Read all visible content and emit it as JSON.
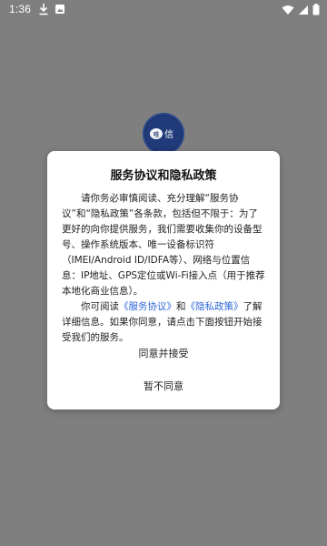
{
  "status_bar": {
    "time": "1:36"
  },
  "app": {
    "logo_text": "唯信"
  },
  "dialog": {
    "title": "服务协议和隐私政策",
    "p1": "请你务必审慎阅读、充分理解“服务协议”和“隐私政策”各条款，包括但不限于：为了更好的向你提供服务，我们需要收集你的设备型号、操作系统版本、唯一设备标识符（IMEI/Android ID/IDFA等）、网络与位置信息：IP地址、GPS定位或Wi-Fi接入点（用于推荐本地化商业信息）。",
    "p2_prefix": "你可阅读",
    "link_service": "《服务协议》",
    "p2_and": "和",
    "link_privacy": "《隐私政策》",
    "p2_suffix": "了解详细信息。如果你同意，请点击下面按钮开始接受我们的服务。",
    "agree_label": "同意并接受",
    "disagree_label": "暂不同意"
  },
  "colors": {
    "overlay": "#7f7f7f",
    "link": "#2e66d8",
    "logo_bg": "#1a2e63"
  }
}
